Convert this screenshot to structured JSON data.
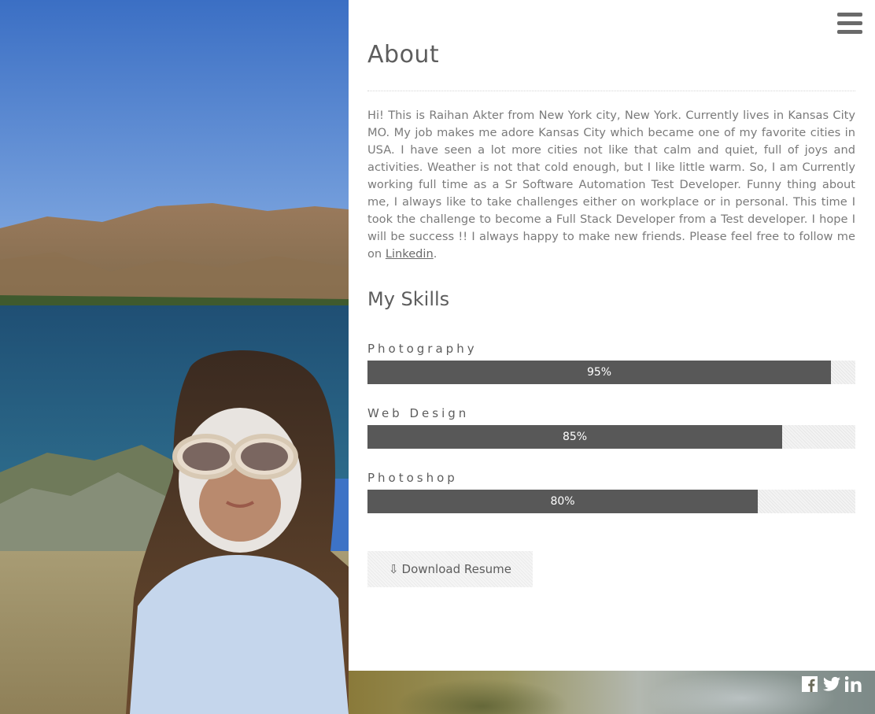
{
  "about": {
    "title": "About",
    "bio_text": "Hi! This is Raihan Akter from New York city, New York. Currently lives in Kansas City MO. My job makes me adore Kansas City which became one of my favorite cities in USA. I have seen a lot more cities not like that calm and quiet, full of joys and activities. Weather is not that cold enough, but I like little warm. So, I am Currently working full time as a Sr Software Automation Test Developer. Funny thing about me, I always like to take challenges either on workplace or in personal. This time I took the challenge to become a Full Stack Developer from a Test developer. I hope I will be success !! I always happy to make new friends. Please feel free to follow me on ",
    "link_text": "Linkedin",
    "bio_end": "."
  },
  "skills": {
    "title": "My Skills",
    "items": [
      {
        "name": "Photography",
        "percent": 95,
        "label": "95%"
      },
      {
        "name": "Web Design",
        "percent": 85,
        "label": "85%"
      },
      {
        "name": "Photoshop",
        "percent": 80,
        "label": "80%"
      }
    ]
  },
  "resume_button": {
    "icon": "download-icon",
    "label": "Download Resume"
  },
  "menu": {
    "icon": "hamburger-menu-icon"
  },
  "social": [
    {
      "icon": "facebook-icon"
    },
    {
      "icon": "twitter-icon"
    },
    {
      "icon": "linkedin-icon"
    }
  ],
  "colors": {
    "bar_fill": "#585858",
    "bar_track": "#eeeeee",
    "text": "#7a7a7a",
    "heading": "#5d5d5d"
  }
}
